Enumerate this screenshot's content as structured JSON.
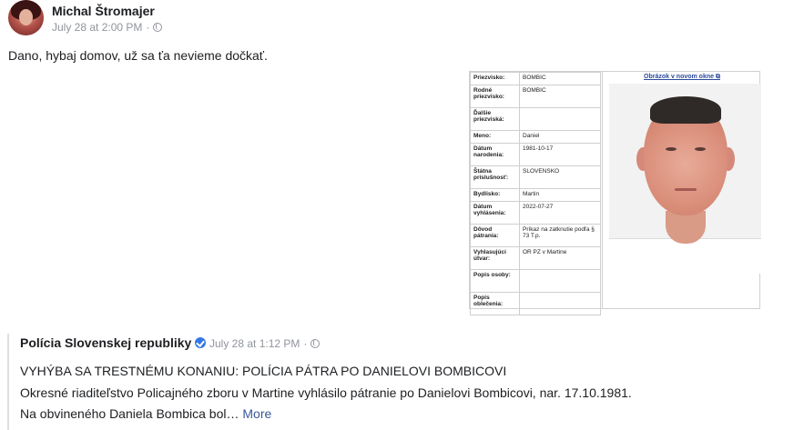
{
  "post": {
    "author": "Michal Štromajer",
    "timestamp": "July 28 at 2:00 PM",
    "separator": "·",
    "text": "Dano, hybaj domov, už sa ťa nevieme dočkať."
  },
  "attachment": {
    "image_link": "Obrázok v novom okne",
    "rows": [
      {
        "label": "Priezvisko:",
        "value": "BOMBIC"
      },
      {
        "label": "Rodné priezvisko:",
        "value": "BOMBIC"
      },
      {
        "label": "Ďalšie priezviská:",
        "value": ""
      },
      {
        "label": "Meno:",
        "value": "Daniel"
      },
      {
        "label": "Dátum narodenia:",
        "value": "1981-10-17"
      },
      {
        "label": "Štátna príslušnosť:",
        "value": "SLOVENSKO"
      },
      {
        "label": "Bydlisko:",
        "value": "Martin"
      },
      {
        "label": "Dátum vyhlásenia:",
        "value": "2022-07-27"
      },
      {
        "label": "Dôvod pátrania:",
        "value": "Príkaz na zatknutie podľa § 73 T.p."
      },
      {
        "label": "Vyhlasujúci útvar:",
        "value": "OR PZ v Martine"
      },
      {
        "label": "Popis osoby:",
        "value": ""
      },
      {
        "label": "Popis oblečenia:",
        "value": ""
      }
    ]
  },
  "shared": {
    "author": "Polícia Slovenskej republiky",
    "timestamp": "July 28 at 1:12 PM",
    "separator": "·",
    "headline": "VYHÝBA SA TRESTNÉMU KONANIU: POLÍCIA PÁTRA PO DANIELOVI BOMBICOVI",
    "line2": "Okresné riaditeľstvo Policajného zboru v Martine vyhlásilo pátranie po Danielovi Bombicovi, nar. 17.10.1981.",
    "line3": "Na obvineného Daniela Bombica bol…",
    "more": "More"
  },
  "icons": {
    "globe": "globe-icon",
    "verified": "verified-badge-icon",
    "external": "external-link-icon"
  },
  "colors": {
    "link": "#385898",
    "meta": "#90949c",
    "verified": "#3578e5"
  }
}
